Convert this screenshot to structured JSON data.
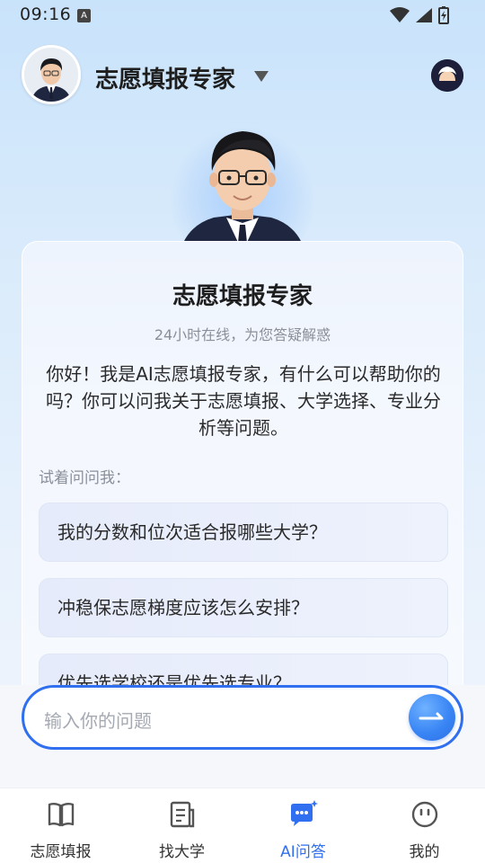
{
  "status_bar": {
    "time": "09:16",
    "notification_glyph": "A"
  },
  "header": {
    "title": "志愿填报专家"
  },
  "card": {
    "title": "志愿填报专家",
    "subtitle": "24小时在线，为您答疑解惑",
    "greeting": "你好！我是AI志愿填报专家，有什么可以帮助你的吗？你可以问我关于志愿填报、大学选择、专业分析等问题。",
    "try_label": "试着问问我：",
    "suggestions": [
      "我的分数和位次适合报哪些大学？",
      "冲稳保志愿梯度应该怎么安排？",
      "优先选学校还是优先选专业？"
    ]
  },
  "input": {
    "placeholder": "输入你的问题"
  },
  "nav": {
    "items": [
      {
        "label": "志愿填报",
        "icon": "book-icon"
      },
      {
        "label": "找大学",
        "icon": "document-icon"
      },
      {
        "label": "AI问答",
        "icon": "chat-ai-icon",
        "active": true
      },
      {
        "label": "我的",
        "icon": "smile-face-icon"
      }
    ]
  },
  "colors": {
    "accent": "#2f6ff0",
    "background": "#dcecfb"
  }
}
